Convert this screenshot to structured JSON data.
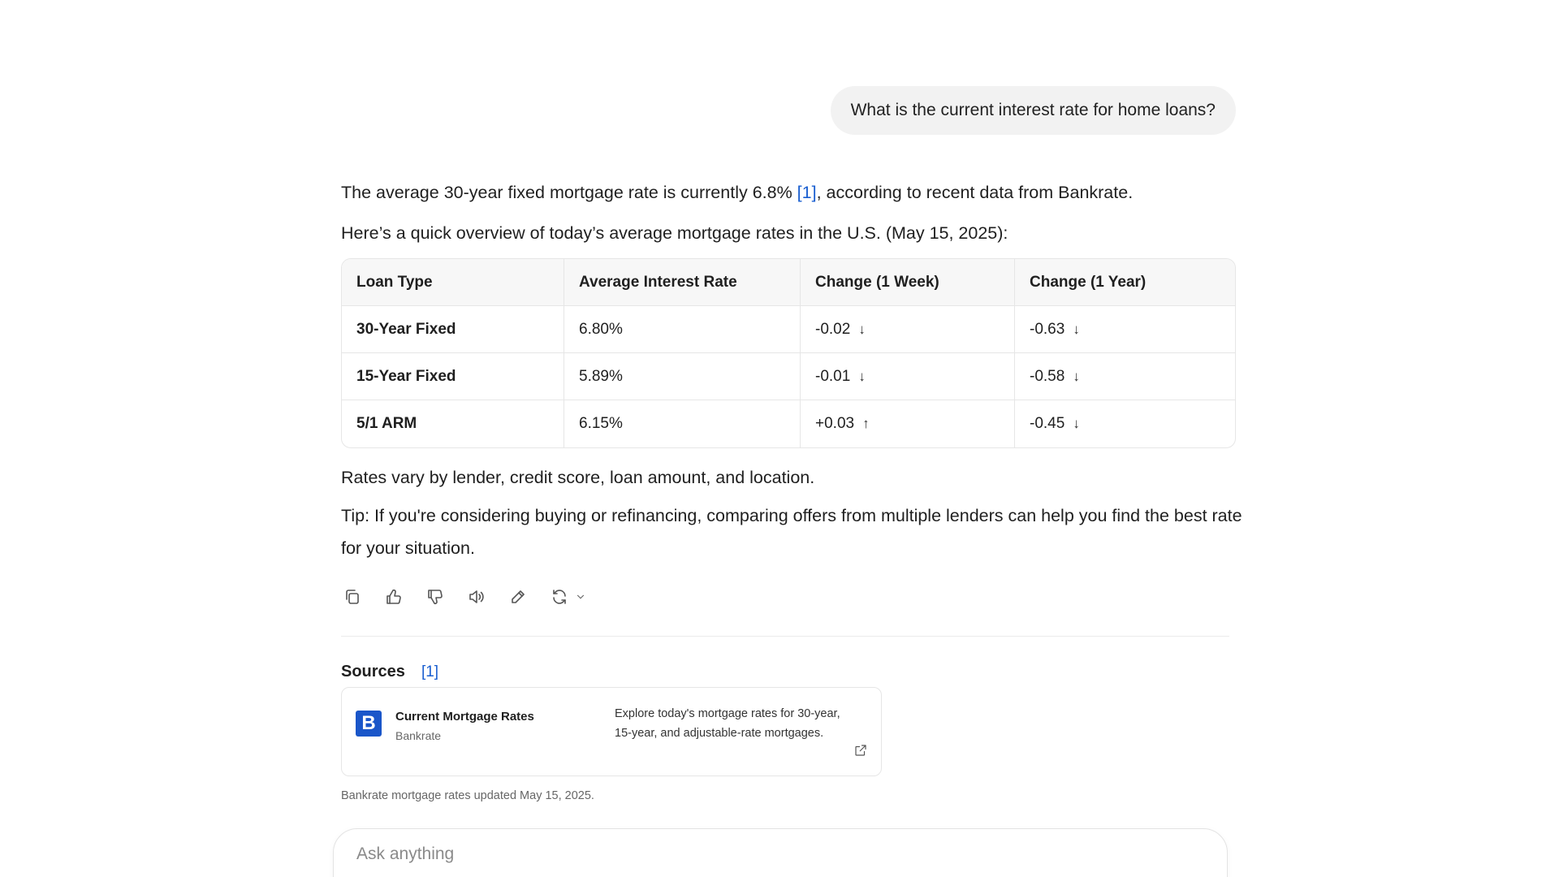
{
  "user_message": "What is the current interest rate for home loans?",
  "answer": {
    "para1_before": "The average 30-year fixed mortgage rate is currently 6.8% ",
    "para1_cite": "[1]",
    "para1_after": ", according to recent data from Bankrate.",
    "para2": "Here’s a quick overview of today’s average mortgage rates in the U.S. (May 15, 2025):",
    "table": {
      "headers": [
        "Loan Type",
        "Average Interest Rate",
        "Change (1 Week)",
        "Change (1 Year)"
      ],
      "rows": [
        {
          "loan": "30-Year Fixed",
          "rate": "6.80%",
          "week": "-0.02",
          "week_dir": "↓",
          "year": "-0.63",
          "year_dir": "↓"
        },
        {
          "loan": "15-Year Fixed",
          "rate": "5.89%",
          "week": "-0.01",
          "week_dir": "↓",
          "year": "-0.58",
          "year_dir": "↓"
        },
        {
          "loan": "5/1 ARM",
          "rate": "6.15%",
          "week": "+0.03",
          "week_dir": "↑",
          "year": "-0.45",
          "year_dir": "↓"
        }
      ]
    },
    "para3": "Rates vary by lender, credit score, loan amount, and location.",
    "para4": "Tip: If you're considering buying or refinancing, comparing offers from multiple lenders can help you find the best rate for your situation."
  },
  "actions": [
    "copy-icon",
    "thumbs-up-icon",
    "thumbs-down-icon",
    "speaker-icon",
    "edit-icon",
    "regenerate-icon",
    "chevron-down-icon"
  ],
  "sources": {
    "heading": "Sources",
    "cite": "[1]",
    "card": {
      "logo_letter": "B",
      "title": "Current Mortgage Rates",
      "site": "Bankrate",
      "description": "Explore today's mortgage rates for 30-year, 15-year, and adjustable-rate mortgages.",
      "brand_color": "#1a56c9"
    },
    "footnote": "Bankrate mortgage rates updated May 15, 2025."
  },
  "composer": {
    "placeholder": "Ask anything"
  },
  "colors": {
    "citation": "#1a5fd0",
    "user_bubble": "#f2f2f2"
  }
}
